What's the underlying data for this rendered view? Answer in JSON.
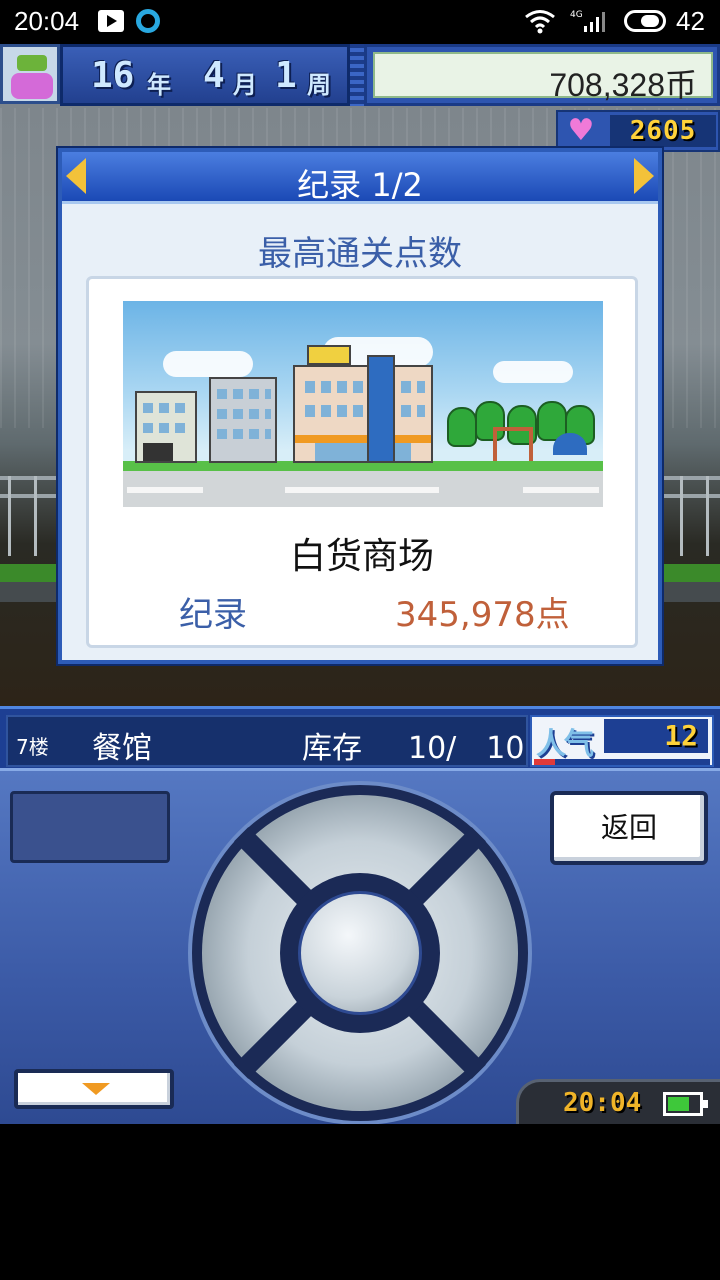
{
  "status_bar": {
    "time": "20:04",
    "network": "4G",
    "battery_level": "42",
    "icons": [
      "play-icon",
      "ring-icon",
      "wifi-icon",
      "signal-icon",
      "battery-icon"
    ]
  },
  "hud": {
    "year": "16",
    "year_unit": "年",
    "month": "4",
    "month_unit": "月",
    "week": "1",
    "week_unit": "周",
    "money": "708,328币",
    "hearts": "2605"
  },
  "dialog": {
    "title": "纪录 1/2",
    "subtitle": "最高通关点数",
    "store_name": "白货商场",
    "record_label": "纪录",
    "record_value": "345,978点"
  },
  "info_bar": {
    "floor": "7楼",
    "shop": "餐馆",
    "stock_label": "库存",
    "stock_count": "10/　10",
    "popularity_label": "人气",
    "popularity_value": "12",
    "popularity_fraction": 0.12
  },
  "controller": {
    "back_label": "返回",
    "clock": "20:04",
    "battery_fraction": 0.7
  },
  "colors": {
    "accent_blue": "#2d5cb8",
    "record_value": "#c0603a",
    "label_blue": "#3b5fa8",
    "digit_yellow": "#ffd23a"
  }
}
